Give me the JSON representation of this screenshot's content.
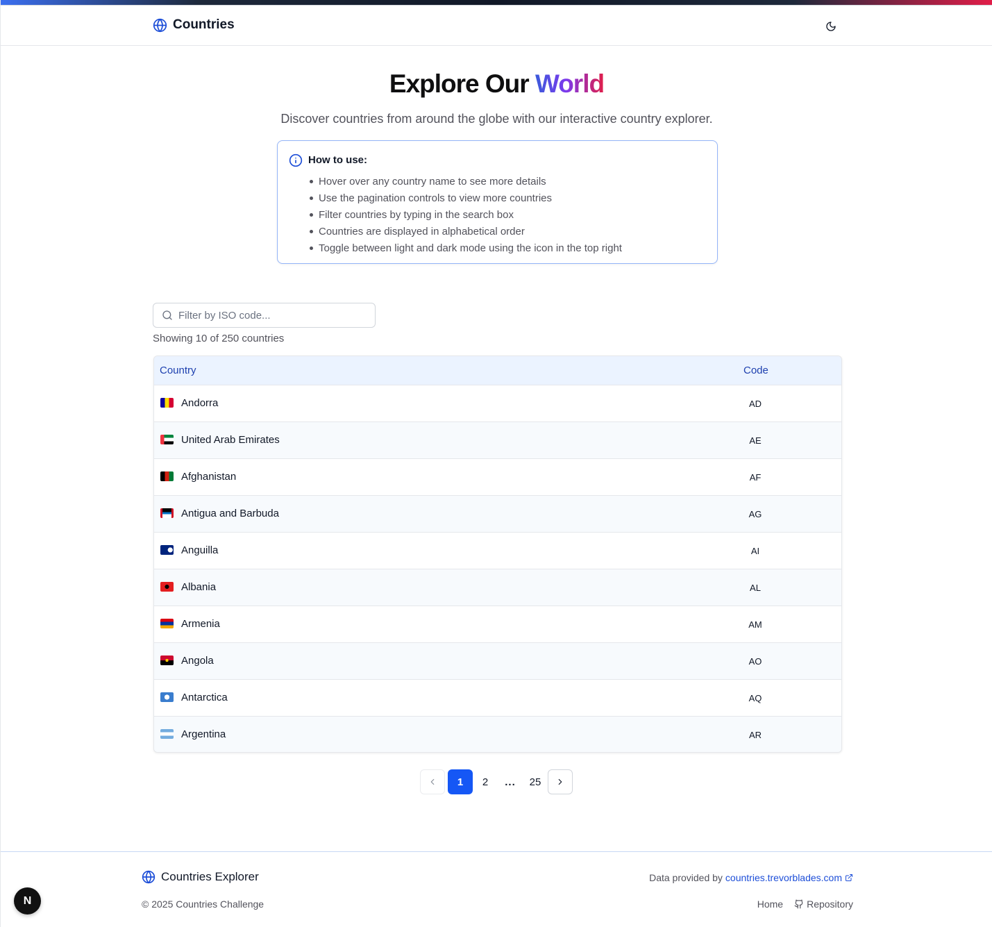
{
  "header": {
    "brand": "Countries",
    "theme_toggle_icon": "moon-icon"
  },
  "hero": {
    "title_main": "Explore Our",
    "title_accent": "World",
    "subtitle": "Discover countries from around the globe with our interactive country explorer."
  },
  "info": {
    "title": "How to use:",
    "items": [
      "Hover over any country name to see more details",
      "Use the pagination controls to view more countries",
      "Filter countries by typing in the search box",
      "Countries are displayed in alphabetical order",
      "Toggle between light and dark mode using the icon in the top right"
    ]
  },
  "search": {
    "placeholder": "Filter by ISO code...",
    "value": ""
  },
  "showing": "Showing 10 of 250 countries",
  "table": {
    "columns": [
      "Country",
      "Code"
    ],
    "rows": [
      {
        "name": "Andorra",
        "code": "AD"
      },
      {
        "name": "United Arab Emirates",
        "code": "AE"
      },
      {
        "name": "Afghanistan",
        "code": "AF"
      },
      {
        "name": "Antigua and Barbuda",
        "code": "AG"
      },
      {
        "name": "Anguilla",
        "code": "AI"
      },
      {
        "name": "Albania",
        "code": "AL"
      },
      {
        "name": "Armenia",
        "code": "AM"
      },
      {
        "name": "Angola",
        "code": "AO"
      },
      {
        "name": "Antarctica",
        "code": "AQ"
      },
      {
        "name": "Argentina",
        "code": "AR"
      }
    ]
  },
  "pagination": {
    "pages": [
      "1",
      "2",
      "...",
      "25"
    ],
    "current": "1"
  },
  "footer": {
    "brand": "Countries Explorer",
    "copyright": "© 2025 Countries Challenge",
    "data_prefix": "Data provided by",
    "data_link": "countries.trevorblades.com",
    "home": "Home",
    "repository": "Repository"
  },
  "next_badge": "N",
  "colors": {
    "primary": "#1557f5",
    "header_text": "#1e40af",
    "title_gradient": [
      "#3b5bdb",
      "#7c3aed",
      "#e11d48"
    ]
  }
}
